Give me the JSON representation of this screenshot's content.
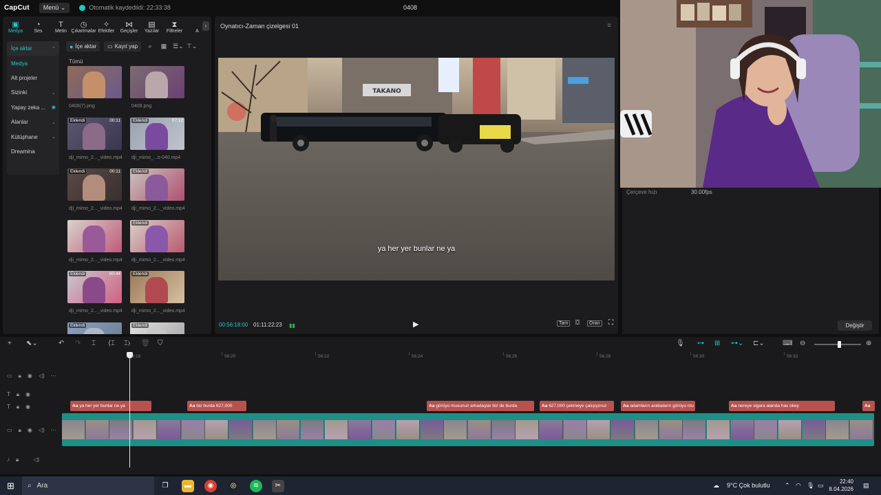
{
  "titlebar": {
    "app_name": "CapCut",
    "menu_label": "Menü",
    "autosave_text": "Otomatik kaydedildi: 22:33:38",
    "project_name": "0408"
  },
  "categories": [
    {
      "label": "Medya",
      "icon": "media-icon"
    },
    {
      "label": "Ses",
      "icon": "audio-icon"
    },
    {
      "label": "Metin",
      "icon": "text-icon"
    },
    {
      "label": "Çıkartmalar",
      "icon": "sticker-icon"
    },
    {
      "label": "Efektler",
      "icon": "effects-icon"
    },
    {
      "label": "Geçişler",
      "icon": "transitions-icon"
    },
    {
      "label": "Yazılar",
      "icon": "captions-icon"
    },
    {
      "label": "Filtreler",
      "icon": "filters-icon"
    },
    {
      "label": "A",
      "icon": "adjust-icon"
    }
  ],
  "sidenav": [
    {
      "label": "İçe aktar",
      "chev": "⌃"
    },
    {
      "label": "Medya",
      "chev": ""
    },
    {
      "label": "Alt projeler",
      "chev": ""
    },
    {
      "label": "Sizinki",
      "chev": "⌄"
    },
    {
      "label": "Yapay zeka ...",
      "chev": "◉"
    },
    {
      "label": "Alanlar",
      "chev": "⌄"
    },
    {
      "label": "Kütüphane",
      "chev": "⌄"
    },
    {
      "label": "Dreamina",
      "chev": ""
    }
  ],
  "media_toolbar": {
    "import_label": "İçe aktar",
    "record_label": "Kayıt yap"
  },
  "media_section_label": "Tümü",
  "media_items": [
    {
      "name": "0408(7).png",
      "badge": "",
      "duration": "",
      "colors": [
        "#8f6b58",
        "#c58f6a",
        "#6a5a8c"
      ]
    },
    {
      "name": "0408.png",
      "badge": "",
      "duration": "",
      "colors": [
        "#7a6c72",
        "#b9a7ab",
        "#6b3f73"
      ]
    },
    {
      "name": "dji_mimo_2..._video.mp4",
      "badge": "Eklendi",
      "duration": "00:11",
      "colors": [
        "#5d5870",
        "#8b6a8a",
        "#3a3550"
      ]
    },
    {
      "name": "dji_mimo_...o-040.mp4",
      "badge": "Eklendi",
      "duration": "07:12",
      "colors": [
        "#9aa0b0",
        "#7a4aa0",
        "#c0c4cc"
      ]
    },
    {
      "name": "dji_mimo_2..._video.mp4",
      "badge": "Eklendi",
      "duration": "00:11",
      "colors": [
        "#5a4a48",
        "#b28d7c",
        "#3a2e30"
      ]
    },
    {
      "name": "dji_mimo_2..._video.mp4",
      "badge": "Eklendi",
      "duration": "",
      "colors": [
        "#c9c4c0",
        "#8a5a9a",
        "#b05070"
      ]
    },
    {
      "name": "dji_mimo_2..._video.mp4",
      "badge": "",
      "duration": "",
      "colors": [
        "#d8d2cc",
        "#9a5a9a",
        "#c05a7a"
      ]
    },
    {
      "name": "dji_mimo_2..._video.mp4",
      "badge": "Eklendi",
      "duration": "",
      "colors": [
        "#d8d0c8",
        "#8a58a8",
        "#b85a70"
      ]
    },
    {
      "name": "dji_mimo_2..._video.mp4",
      "badge": "Eklendi",
      "duration": "00:44",
      "colors": [
        "#c8c8d0",
        "#8a4a8a",
        "#d06080"
      ]
    },
    {
      "name": "dji_mimo_2..._video.mp4",
      "badge": "Eklendi",
      "duration": "",
      "colors": [
        "#9a7a5a",
        "#b04a50",
        "#d8c0a0"
      ]
    },
    {
      "name": "",
      "badge": "Eklendi",
      "duration": "",
      "colors": [
        "#8aa0c0",
        "#b0b8c8",
        "#6a7a90"
      ]
    },
    {
      "name": "",
      "badge": "Eklendi",
      "duration": "",
      "colors": [
        "#e0e0e0",
        "#c8c8c8",
        "#a0a0a0"
      ]
    }
  ],
  "player": {
    "title": "Oynatıcı-Zaman çizelgesi 01",
    "subtitle": "ya her yer bunlar ne ya",
    "current_time": "00:56:18:00",
    "total_time": "01:11:22:23",
    "full_label": "Tam",
    "ratio_label": "Oran"
  },
  "properties": {
    "framerate_label": "Çerçeve hızı",
    "framerate_value": "30.00fps",
    "change_button": "Değiştir"
  },
  "timeline": {
    "ruler_ticks": [
      "56:18",
      "56:20",
      "56:22",
      "56:24",
      "56:26",
      "56:28",
      "56:30",
      "56:32"
    ],
    "subtitle_clips": [
      {
        "label": "ya her yer bunlar ne ya"
      },
      {
        "label": "biz burda 627,000"
      },
      {
        "label": "görüyo musunuz arkadaşlar biz de burda"
      },
      {
        "label": "627,000 çekmeye çalışıyoruz"
      },
      {
        "label": "adamların arabaların görüyo mu"
      },
      {
        "label": "nereye sigara alanda has okey"
      },
      {
        "label": ""
      }
    ]
  },
  "taskbar": {
    "search_placeholder": "Ara",
    "weather": "9°C  Çok bulutlu",
    "time": "22:40",
    "date": "8.04.2026"
  }
}
